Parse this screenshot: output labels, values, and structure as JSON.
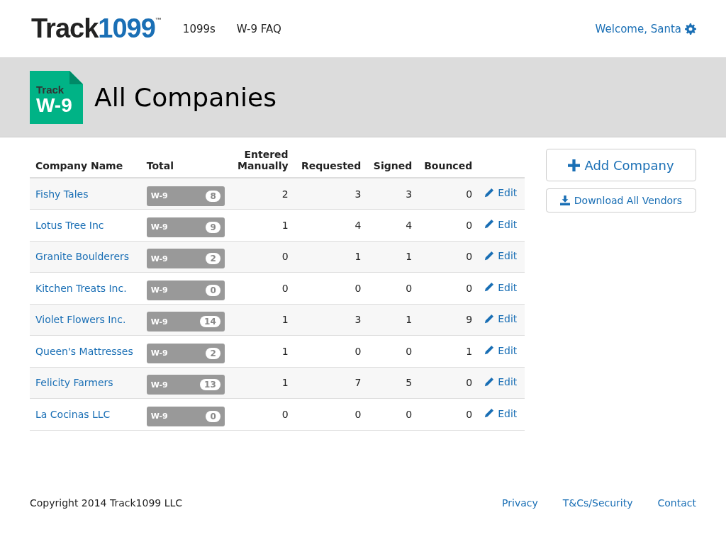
{
  "header": {
    "logo": {
      "word": "Track",
      "number": "1099",
      "mark": "™"
    },
    "nav": [
      "1099s",
      "W-9 FAQ"
    ],
    "welcome": "Welcome, Santa"
  },
  "page": {
    "badge": {
      "top": "Track",
      "bottom": "W-9"
    },
    "title": "All Companies"
  },
  "table": {
    "columns": [
      "Company Name",
      "Total",
      "Entered Manually",
      "Requested",
      "Signed",
      "Bounced"
    ],
    "rows": [
      {
        "name": "Fishy Tales",
        "form": "W-9",
        "total": "8",
        "entered": "2",
        "requested": "3",
        "signed": "3",
        "bounced": "0",
        "action": "Edit"
      },
      {
        "name": "Lotus Tree Inc",
        "form": "W-9",
        "total": "9",
        "entered": "1",
        "requested": "4",
        "signed": "4",
        "bounced": "0",
        "action": "Edit"
      },
      {
        "name": "Granite Boulderers",
        "form": "W-9",
        "total": "2",
        "entered": "0",
        "requested": "1",
        "signed": "1",
        "bounced": "0",
        "action": "Edit"
      },
      {
        "name": "Kitchen Treats Inc.",
        "form": "W-9",
        "total": "0",
        "entered": "0",
        "requested": "0",
        "signed": "0",
        "bounced": "0",
        "action": "Edit"
      },
      {
        "name": "Violet Flowers Inc.",
        "form": "W-9",
        "total": "14",
        "entered": "1",
        "requested": "3",
        "signed": "1",
        "bounced": "9",
        "action": "Edit"
      },
      {
        "name": "Queen's Mattresses",
        "form": "W-9",
        "total": "2",
        "entered": "1",
        "requested": "0",
        "signed": "0",
        "bounced": "1",
        "action": "Edit"
      },
      {
        "name": "Felicity Farmers",
        "form": "W-9",
        "total": "13",
        "entered": "1",
        "requested": "7",
        "signed": "5",
        "bounced": "0",
        "action": "Edit"
      },
      {
        "name": "La Cocinas LLC",
        "form": "W-9",
        "total": "0",
        "entered": "0",
        "requested": "0",
        "signed": "0",
        "bounced": "0",
        "action": "Edit"
      }
    ]
  },
  "actions": {
    "add": "Add Company",
    "download": "Download All Vendors"
  },
  "footer": {
    "copyright": "Copyright 2014 Track1099 LLC",
    "links": [
      "Privacy",
      "T&Cs/Security",
      "Contact"
    ]
  }
}
